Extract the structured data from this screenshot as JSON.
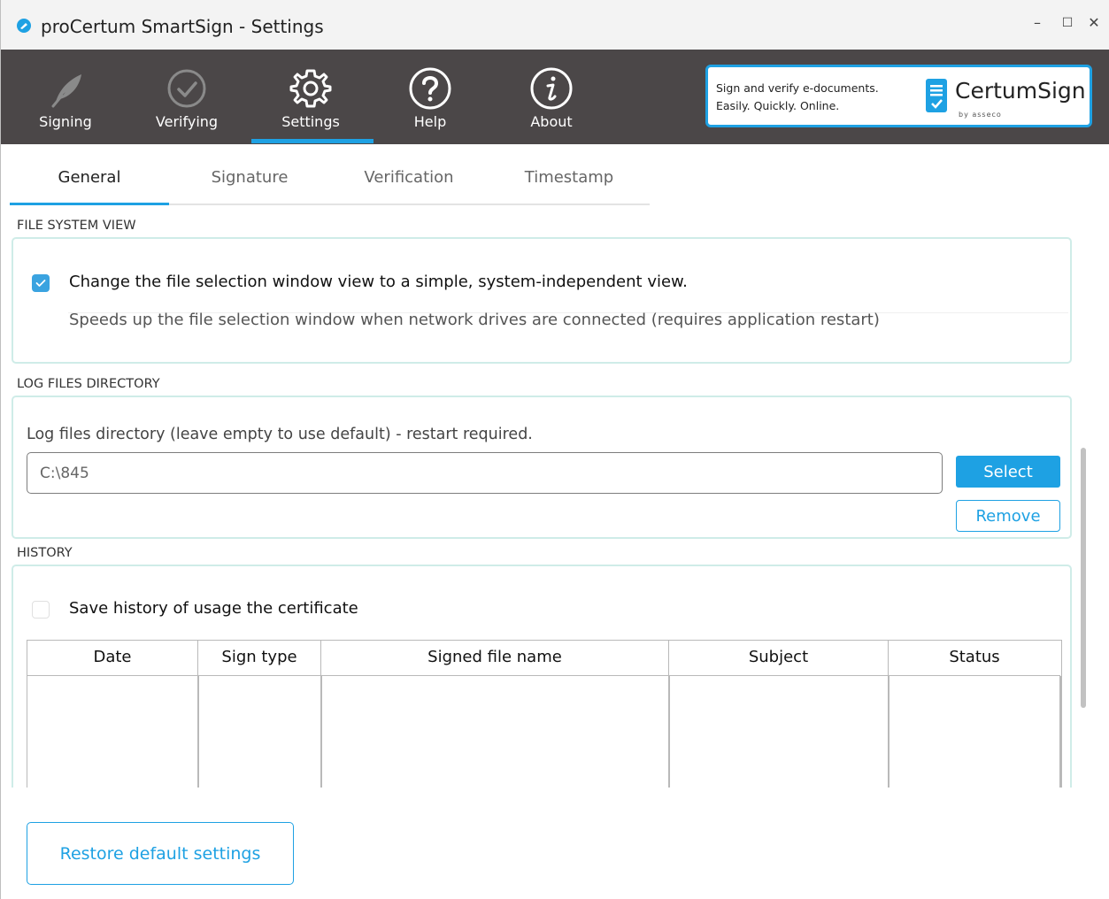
{
  "window": {
    "title": "proCertum SmartSign - Settings",
    "controls": {
      "minimize": "–",
      "maximize": "☐",
      "close": "✕"
    }
  },
  "nav": {
    "items": [
      {
        "label": "Signing",
        "icon": "feather-icon"
      },
      {
        "label": "Verifying",
        "icon": "check-circle-icon"
      },
      {
        "label": "Settings",
        "icon": "gear-icon",
        "active": true
      },
      {
        "label": "Help",
        "icon": "question-circle-icon"
      },
      {
        "label": "About",
        "icon": "info-circle-icon"
      }
    ]
  },
  "promo": {
    "line1": "Sign and verify e-documents.",
    "line2": "Easily. Quickly. Online.",
    "brand": "CertumSign",
    "sub": "by asseco"
  },
  "tabs": [
    {
      "label": "General",
      "active": true
    },
    {
      "label": "Signature"
    },
    {
      "label": "Verification"
    },
    {
      "label": "Timestamp"
    }
  ],
  "file_system_view": {
    "title": "FILE SYSTEM VIEW",
    "checkbox_checked": true,
    "option_label": "Change the file selection window view to a simple, system-independent view.",
    "description": "Speeds up the file selection window when network drives are connected (requires application restart)"
  },
  "log_files": {
    "title": "LOG FILES DIRECTORY",
    "label": "Log files directory (leave empty to use default) - restart required.",
    "value": "C:\\845",
    "select_label": "Select",
    "remove_label": "Remove"
  },
  "history": {
    "title": "HISTORY",
    "checkbox_checked": false,
    "option_label": "Save history of usage the certificate",
    "columns": [
      "Date",
      "Sign type",
      "Signed file name",
      "Subject",
      "Status"
    ]
  },
  "footer": {
    "restore_label": "Restore default settings"
  },
  "colors": {
    "accent": "#1ea1e3",
    "toolbar": "#4b4748",
    "panel_border": "#cfece8"
  }
}
